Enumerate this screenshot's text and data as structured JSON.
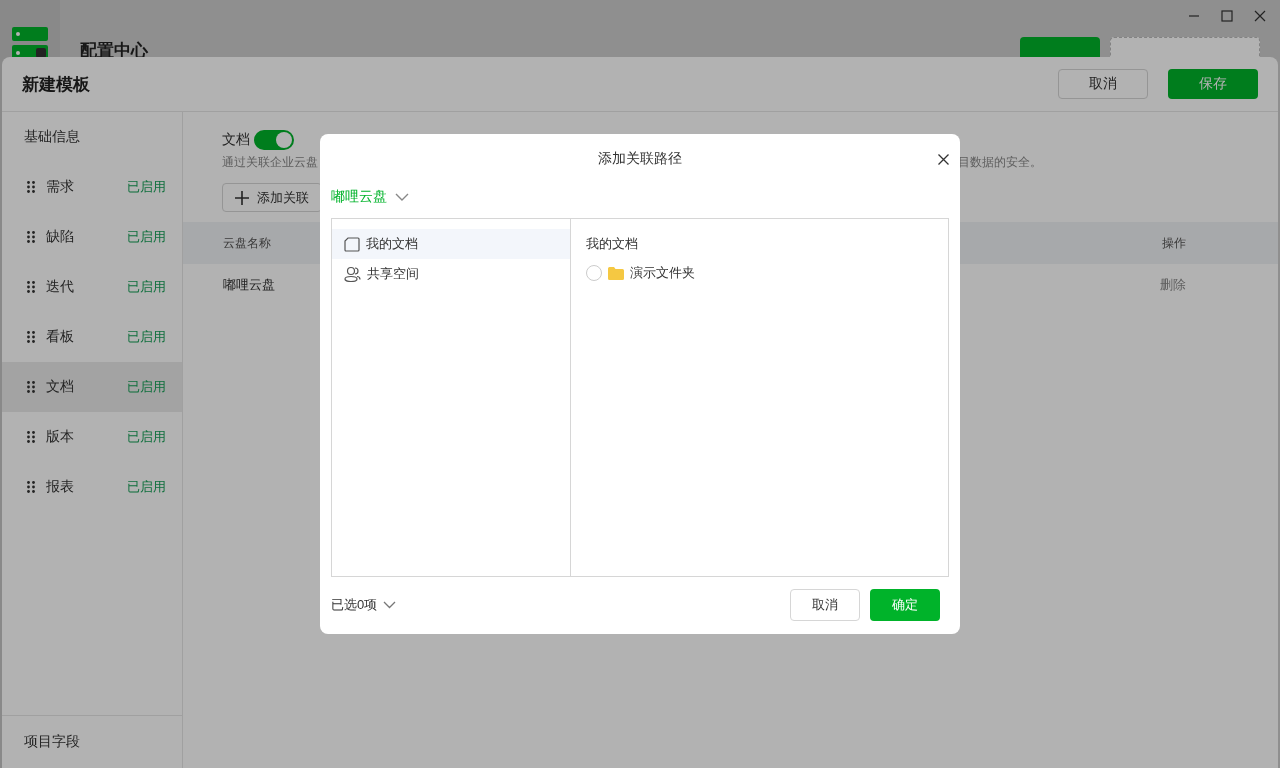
{
  "app": {
    "title": "配置中心"
  },
  "sheet": {
    "title": "新建模板",
    "buttons": [
      {
        "label": "取消",
        "kind": "secondary"
      },
      {
        "label": "保存",
        "kind": "primary"
      }
    ],
    "nav": {
      "header": "基础信息",
      "items": [
        {
          "label": "需求",
          "status": "已启用",
          "selected": false
        },
        {
          "label": "缺陷",
          "status": "已启用",
          "selected": false
        },
        {
          "label": "迭代",
          "status": "已启用",
          "selected": false
        },
        {
          "label": "看板",
          "status": "已启用",
          "selected": false
        },
        {
          "label": "文档",
          "status": "已启用",
          "selected": true
        },
        {
          "label": "版本",
          "status": "已启用",
          "selected": false
        },
        {
          "label": "报表",
          "status": "已启用",
          "selected": false
        }
      ],
      "footer": "项目字段"
    },
    "main": {
      "toggle": {
        "label": "文档",
        "on": true
      },
      "description_parts": [
        "通过关联企业云盘",
        "目数据的安全。"
      ],
      "add_button": "添加关联",
      "table": {
        "columns": [
          "云盘名称",
          "操作"
        ],
        "rows": [
          {
            "name": "嘟哩云盘",
            "action": "删除"
          }
        ]
      }
    }
  },
  "dialog": {
    "title": "添加关联路径",
    "source": "嘟哩云盘",
    "locations": [
      {
        "label": "我的文档",
        "kind": "personal",
        "selected": true
      },
      {
        "label": "共享空间",
        "kind": "shared",
        "selected": false
      }
    ],
    "folder_heading": "我的文档",
    "folders": [
      {
        "name": "演示文件夹",
        "checked": false
      }
    ],
    "selection_summary": "已选0项",
    "buttons": [
      {
        "label": "取消",
        "kind": "secondary"
      },
      {
        "label": "确定",
        "kind": "primary"
      }
    ]
  }
}
